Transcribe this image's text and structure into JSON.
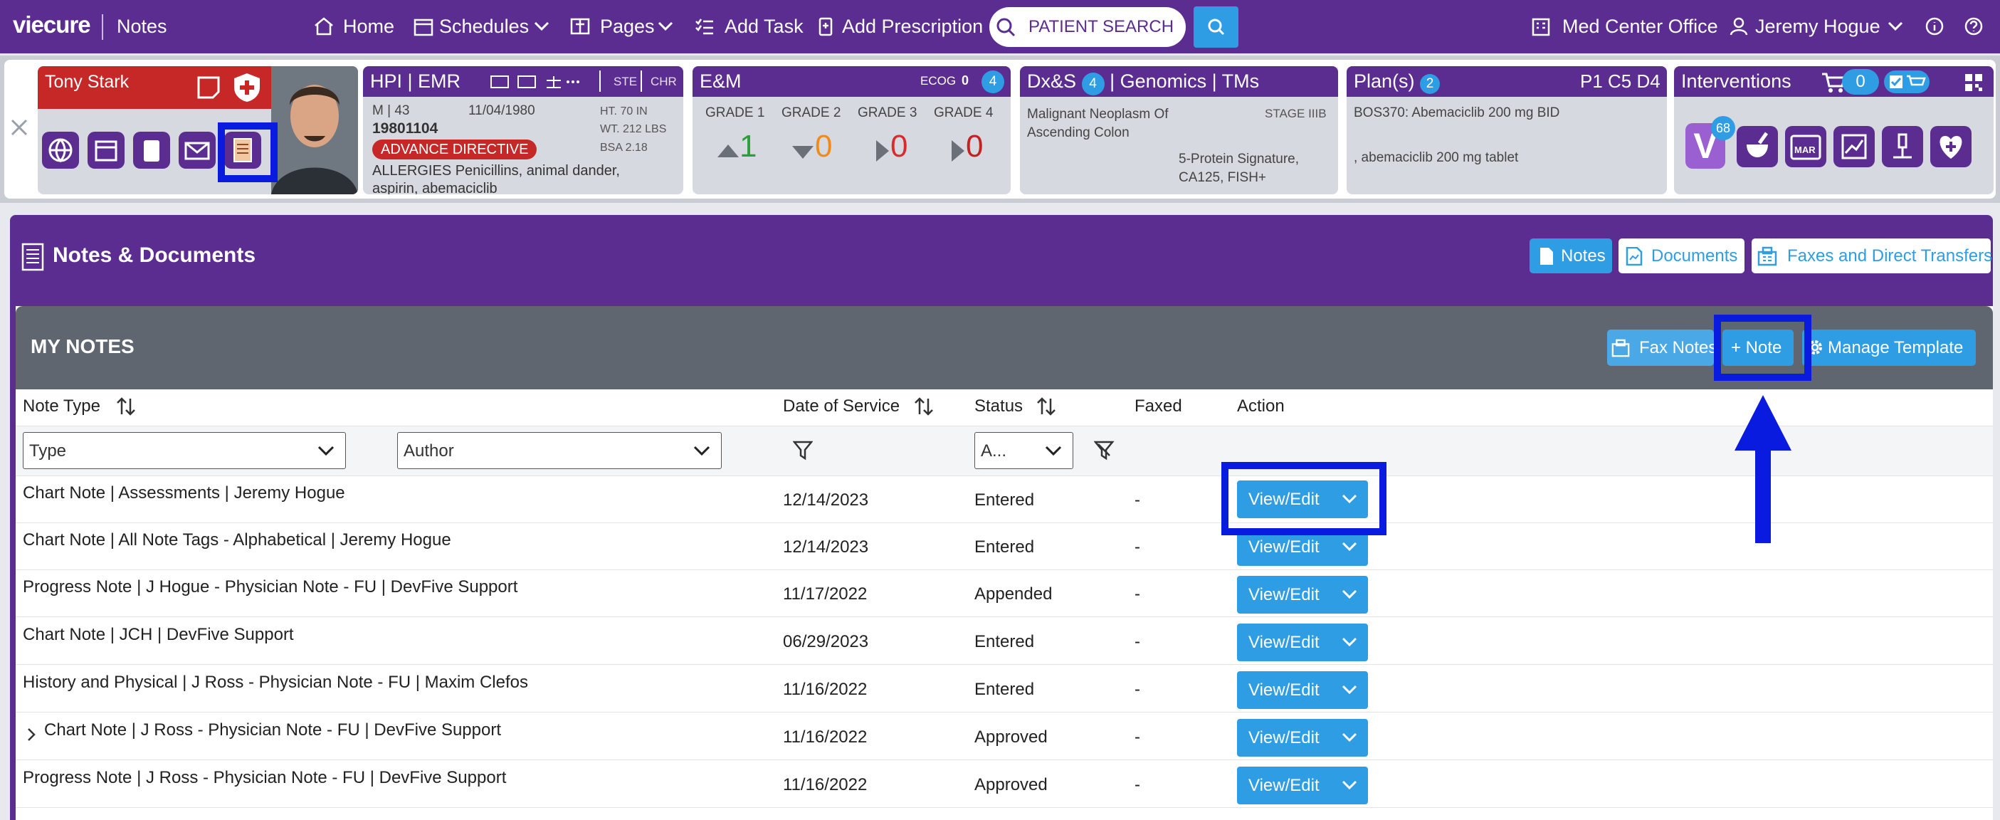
{
  "nav": {
    "logo": "viecure",
    "app": "Notes",
    "home": "Home",
    "schedules": "Schedules",
    "pages": "Pages",
    "add_task": "Add Task",
    "add_prescription": "Add Prescription",
    "search_placeholder": "PATIENT SEARCH",
    "location": "Med Center Office",
    "user": "Jeremy Hogue"
  },
  "patient": {
    "name": "Tony Stark",
    "sex_age": "M | 43",
    "dob": "11/04/1980",
    "mrn": "19801104",
    "height": "HT. 70 IN",
    "weight": "WT. 212 LBS",
    "bsa": "BSA 2.18",
    "advance": "ADVANCE DIRECTIVE",
    "allergies": "ALLERGIES Penicillins, animal dander, aspirin, abemaciclib"
  },
  "hpi": {
    "title": "HPI | EMR",
    "ste": "STE",
    "chr": "CHR"
  },
  "em": {
    "title": "E&M",
    "ecog_label": "ECOG",
    "ecog_value": "0",
    "count": "4",
    "grades": [
      {
        "label": "GRADE 1",
        "value": "1",
        "color": "#2e9e3a"
      },
      {
        "label": "GRADE 2",
        "value": "0",
        "color": "#f08a1c"
      },
      {
        "label": "GRADE 3",
        "value": "0",
        "color": "#d92b2b"
      },
      {
        "label": "GRADE 4",
        "value": "0",
        "color": "#c62020"
      }
    ]
  },
  "dx": {
    "title_a": "Dx&S",
    "count": "4",
    "title_b": "| Genomics | TMs",
    "diagnosis": "Malignant Neoplasm Of Ascending Colon",
    "stage": "STAGE IIIB",
    "genomics": "5-Protein Signature, CA125, FISH+"
  },
  "plan": {
    "title": "Plan(s)",
    "count": "2",
    "cycle": "P1 C5 D4",
    "line1": "BOS370: Abemaciclib 200 mg BID",
    "line2": ", abemaciclib 200 mg tablet"
  },
  "interventions": {
    "title": "Interventions",
    "cart_count": "0",
    "v_count": "68",
    "mar": "MAR"
  },
  "notes_section": {
    "title": "Notes & Documents",
    "tab_notes": "Notes",
    "tab_documents": "Documents",
    "tab_faxes": "Faxes and Direct Transfers",
    "my_notes": "MY NOTES",
    "fax_notes": "Fax Notes",
    "add_note": "+ Note",
    "manage_template": "Manage Template"
  },
  "table": {
    "headers": {
      "type": "Note Type",
      "date": "Date of Service",
      "status": "Status",
      "faxed": "Faxed",
      "action": "Action"
    },
    "filters": {
      "type": "Type",
      "author": "Author",
      "status": "A..."
    },
    "rows": [
      {
        "type": "Chart Note | Assessments | Jeremy Hogue",
        "date": "12/14/2023",
        "status": "Entered",
        "faxed": "-",
        "action": "View/Edit"
      },
      {
        "type": "Chart Note | All Note Tags - Alphabetical | Jeremy Hogue",
        "date": "12/14/2023",
        "status": "Entered",
        "faxed": "-",
        "action": "View/Edit"
      },
      {
        "type": "Progress Note | J Hogue - Physician Note - FU | DevFive Support",
        "date": "11/17/2022",
        "status": "Appended",
        "faxed": "-",
        "action": "View/Edit"
      },
      {
        "type": "Chart Note | JCH | DevFive Support",
        "date": "06/29/2023",
        "status": "Entered",
        "faxed": "-",
        "action": "View/Edit"
      },
      {
        "type": "History and Physical | J Ross - Physician Note - FU | Maxim Clefos",
        "date": "11/16/2022",
        "status": "Entered",
        "faxed": "-",
        "action": "View/Edit"
      },
      {
        "type": "Chart Note | J Ross - Physician Note - FU | DevFive Support",
        "date": "11/16/2022",
        "status": "Approved",
        "faxed": "-",
        "action": "View/Edit"
      },
      {
        "type": "Progress Note | J Ross - Physician Note - FU | DevFive Support",
        "date": "11/16/2022",
        "status": "Approved",
        "faxed": "-",
        "action": "View/Edit"
      }
    ]
  }
}
